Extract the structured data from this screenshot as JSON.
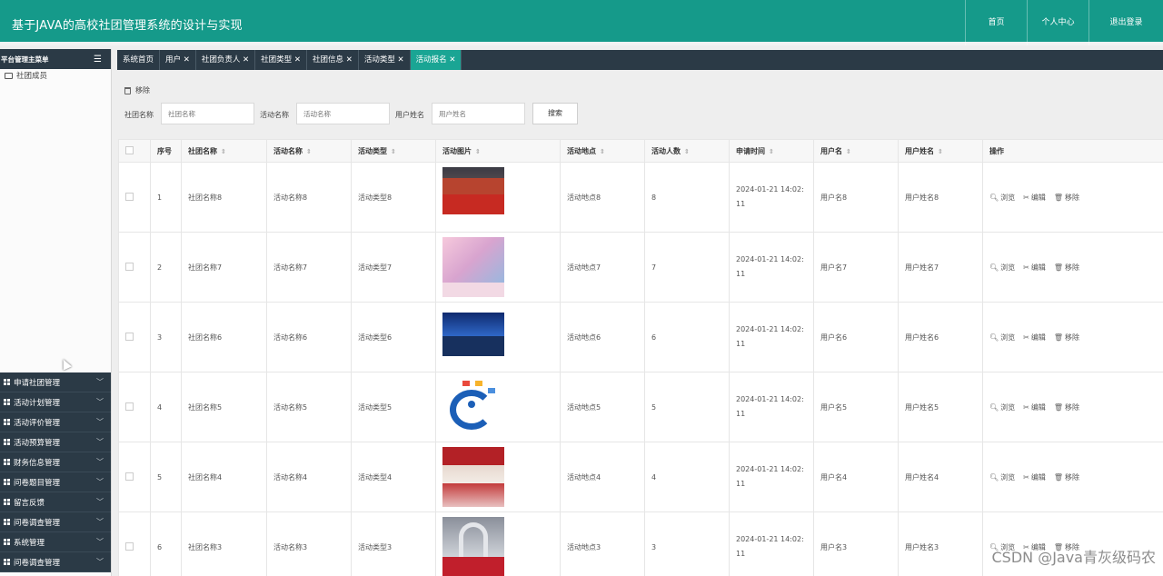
{
  "header": {
    "title": "基于JAVA的高校社团管理系统的设计与实现",
    "nav": [
      "首页",
      "个人中心",
      "退出登录"
    ]
  },
  "sidebar": {
    "menu_title": "平台管理主菜单",
    "sub_item": "社团成员",
    "groups": [
      "申请社团管理",
      "活动计划管理",
      "活动评价管理",
      "活动预算管理",
      "财务信息管理",
      "问卷题目管理",
      "留言反馈",
      "问卷调查管理",
      "系统管理",
      "问卷调查管理"
    ]
  },
  "tabs": [
    {
      "label": "系统首页"
    },
    {
      "label": "用户 ✕"
    },
    {
      "label": "社团负责人 ✕"
    },
    {
      "label": "社团类型 ✕"
    },
    {
      "label": "社团信息 ✕"
    },
    {
      "label": "活动类型 ✕"
    },
    {
      "label": "活动报名 ✕",
      "active": true
    }
  ],
  "search": {
    "remove_label": "移除",
    "fields": [
      {
        "label": "社团名称",
        "placeholder": "社团名称"
      },
      {
        "label": "活动名称",
        "placeholder": "活动名称"
      },
      {
        "label": "用户姓名",
        "placeholder": "用户姓名"
      }
    ],
    "button": "搜索"
  },
  "table": {
    "headers": [
      "序号",
      "社团名称",
      "活动名称",
      "活动类型",
      "活动图片",
      "活动地点",
      "活动人数",
      "申请时间",
      "用户名",
      "用户姓名",
      "操作"
    ],
    "op_labels": {
      "view": "浏览",
      "edit": "编辑",
      "remove": "移除"
    },
    "rows": [
      {
        "no": "1",
        "club": "社团名称8",
        "activity": "活动名称8",
        "type": "活动类型8",
        "place": "活动地点8",
        "count": "8",
        "time": "2024-01-21 14:02:11",
        "username": "用户名8",
        "realname": "用户姓名8",
        "img": "img-red-stage"
      },
      {
        "no": "2",
        "club": "社团名称7",
        "activity": "活动名称7",
        "type": "活动类型7",
        "place": "活动地点7",
        "count": "7",
        "time": "2024-01-21 14:02:11",
        "username": "用户名7",
        "realname": "用户姓名7",
        "img": "img-pink-flowers"
      },
      {
        "no": "3",
        "club": "社团名称6",
        "activity": "活动名称6",
        "type": "活动类型6",
        "place": "活动地点6",
        "count": "6",
        "time": "2024-01-21 14:02:11",
        "username": "用户名6",
        "realname": "用户姓名6",
        "img": "img-blue-hall"
      },
      {
        "no": "4",
        "club": "社团名称5",
        "activity": "活动名称5",
        "type": "活动类型5",
        "place": "活动地点5",
        "count": "5",
        "time": "2024-01-21 14:02:11",
        "username": "用户名5",
        "realname": "用户姓名5",
        "img": "img-logo"
      },
      {
        "no": "5",
        "club": "社团名称4",
        "activity": "活动名称4",
        "type": "活动类型4",
        "place": "活动地点4",
        "count": "4",
        "time": "2024-01-21 14:02:11",
        "username": "用户名4",
        "realname": "用户姓名4",
        "img": "img-red-banquet"
      },
      {
        "no": "6",
        "club": "社团名称3",
        "activity": "活动名称3",
        "type": "活动类型3",
        "place": "活动地点3",
        "count": "3",
        "time": "2024-01-21 14:02:11",
        "username": "用户名3",
        "realname": "用户姓名3",
        "img": "img-arch-aisle"
      }
    ]
  },
  "watermark": "CSDN @Java青灰级码农",
  "colors": {
    "header": "#159a8a",
    "sidebar_dark": "#2b3a46",
    "active_tab": "#1aa594"
  }
}
